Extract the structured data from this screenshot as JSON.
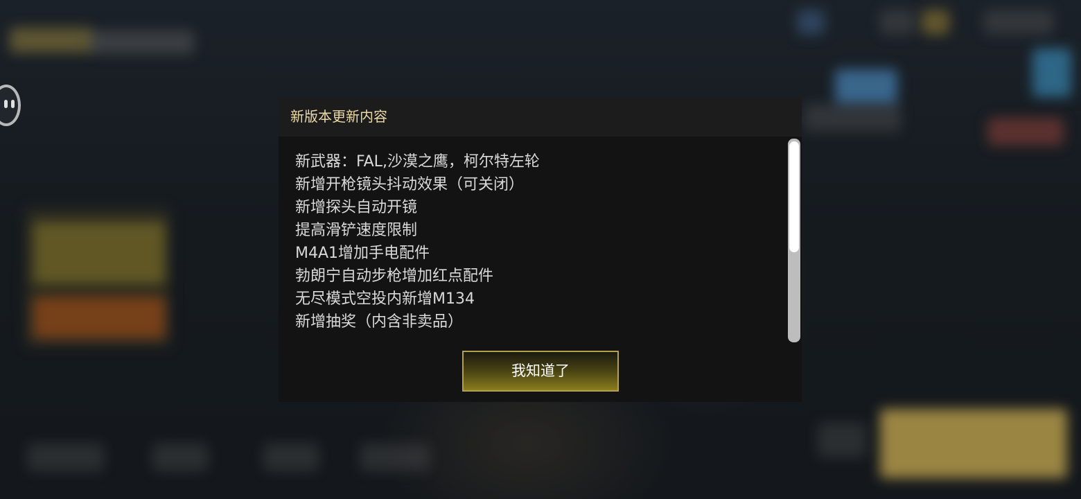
{
  "dialog": {
    "title": "新版本更新内容",
    "items": [
      "新武器：FAL,沙漠之鹰，柯尔特左轮",
      "新增开枪镜头抖动效果（可关闭）",
      "新增探头自动开镜",
      "提高滑铲速度限制",
      "M4A1增加手电配件",
      "勃朗宁自动步枪增加红点配件",
      "无尽模式空投内新增M134",
      "新增抽奖（内含非卖品）"
    ],
    "confirm_label": "我知道了",
    "colors": {
      "title": "#ecd9a8",
      "button_border": "#b3a24a"
    }
  },
  "side_control": {
    "icon": "assistant-face-icon"
  }
}
